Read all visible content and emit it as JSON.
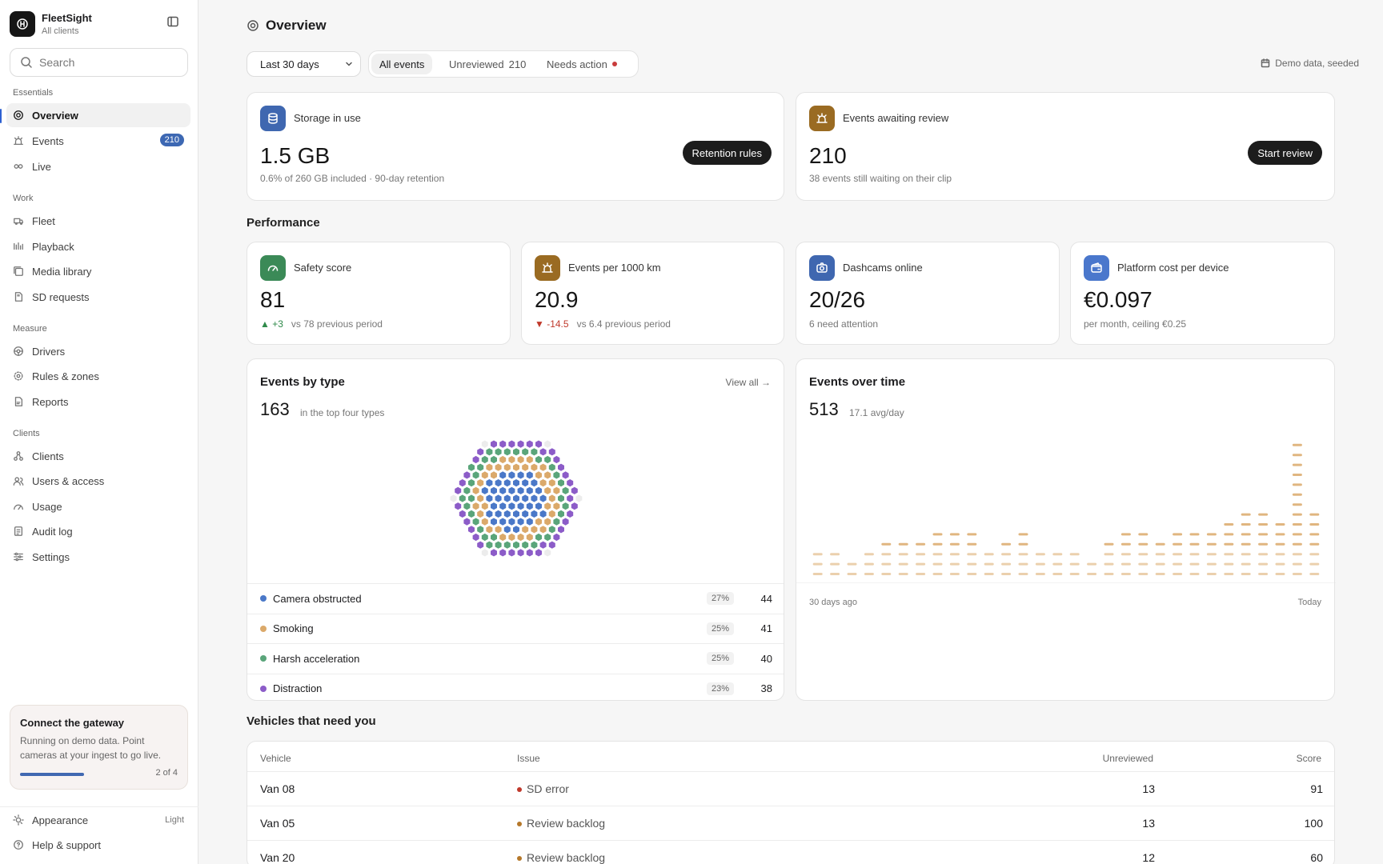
{
  "sidebar": {
    "brand": {
      "name": "FleetSight",
      "subtitle": "All clients"
    },
    "search_placeholder": "Search",
    "sections": {
      "essentials": "Essentials",
      "work": "Work",
      "measure": "Measure",
      "clients": "Clients"
    },
    "items": {
      "overview": "Overview",
      "events": "Events",
      "events_badge": "210",
      "live": "Live",
      "fleet": "Fleet",
      "playback": "Playback",
      "media_library": "Media library",
      "sd_requests": "SD requests",
      "drivers": "Drivers",
      "rules_zones": "Rules & zones",
      "reports": "Reports",
      "clients": "Clients",
      "users_access": "Users & access",
      "usage": "Usage",
      "audit_log": "Audit log",
      "settings": "Settings"
    },
    "gateway": {
      "title": "Connect the gateway",
      "text": "Running on demo data. Point cameras at your ingest to go live.",
      "step": "2 of 4",
      "progress": 0.5
    },
    "footer": {
      "appearance": "Appearance",
      "appearance_value": "Light",
      "help": "Help & support"
    }
  },
  "header": {
    "title": "Overview",
    "range": "Last 30 days",
    "filters": {
      "all": "All events",
      "unreviewed": "Unreviewed",
      "unreviewed_count": "210",
      "needs_action": "Needs action"
    },
    "demo_note": "Demo data, seeded"
  },
  "storage": {
    "title": "Storage in use",
    "value": "1.5 GB",
    "sub": "0.6% of 260 GB included · 90-day retention",
    "button": "Retention rules"
  },
  "review": {
    "title": "Events awaiting review",
    "value": "210",
    "sub": "38 events still waiting on their clip",
    "button": "Start review"
  },
  "performance": {
    "title": "Performance",
    "safety": {
      "title": "Safety score",
      "value": "81",
      "delta": "▲ +3",
      "compare": "vs 78 previous period"
    },
    "events_per_km": {
      "title": "Events per 1000 km",
      "value": "20.9",
      "delta": "▼ -14.5",
      "compare": "vs 6.4 previous period"
    },
    "dashcams": {
      "title": "Dashcams online",
      "value": "20/26",
      "sub": "6 need attention"
    },
    "cost": {
      "title": "Platform cost per device",
      "value": "€0.097",
      "sub": "per month, ceiling €0.25"
    }
  },
  "events_by_type": {
    "title": "Events by type",
    "total": "163",
    "total_sub": "in the top four types",
    "view_all": "View all →",
    "rows": [
      {
        "label": "Camera obstructed",
        "pct": "27%",
        "count": "44",
        "color": "#4a78c8"
      },
      {
        "label": "Smoking",
        "pct": "25%",
        "count": "41",
        "color": "#dba96a"
      },
      {
        "label": "Harsh acceleration",
        "pct": "25%",
        "count": "40",
        "color": "#5aa57a"
      },
      {
        "label": "Distraction",
        "pct": "23%",
        "count": "38",
        "color": "#8c5cc8"
      }
    ]
  },
  "events_over_time": {
    "title": "Events over time",
    "total": "513",
    "avg": "17.1 avg/day",
    "x_start": "30 days ago",
    "x_end": "Today"
  },
  "chart_data": {
    "type": "bar",
    "categories": [
      "1",
      "2",
      "3",
      "4",
      "5",
      "6",
      "7",
      "8",
      "9",
      "10",
      "11",
      "12",
      "13",
      "14",
      "15",
      "16",
      "17",
      "18",
      "19",
      "20",
      "21",
      "22",
      "23",
      "24",
      "25",
      "26",
      "27",
      "28",
      "29",
      "30"
    ],
    "values": [
      3,
      3,
      2,
      3,
      4,
      4,
      4,
      5,
      5,
      5,
      3,
      4,
      5,
      3,
      3,
      3,
      2,
      4,
      5,
      5,
      4,
      5,
      5,
      5,
      6,
      7,
      7,
      6,
      14,
      7
    ],
    "color": "#dba96a"
  },
  "vehicles": {
    "title": "Vehicles that need you",
    "columns": {
      "vehicle": "Vehicle",
      "issue": "Issue",
      "unreviewed": "Unreviewed",
      "score": "Score"
    },
    "rows": [
      {
        "vehicle": "Van 08",
        "issue": "SD error",
        "issue_color": "#c0392b",
        "unreviewed": "13",
        "score": "91"
      },
      {
        "vehicle": "Van 05",
        "issue": "Review backlog",
        "issue_color": "#b5782a",
        "unreviewed": "13",
        "score": "100"
      },
      {
        "vehicle": "Van 20",
        "issue": "Review backlog",
        "issue_color": "#b5782a",
        "unreviewed": "12",
        "score": "60"
      }
    ]
  }
}
